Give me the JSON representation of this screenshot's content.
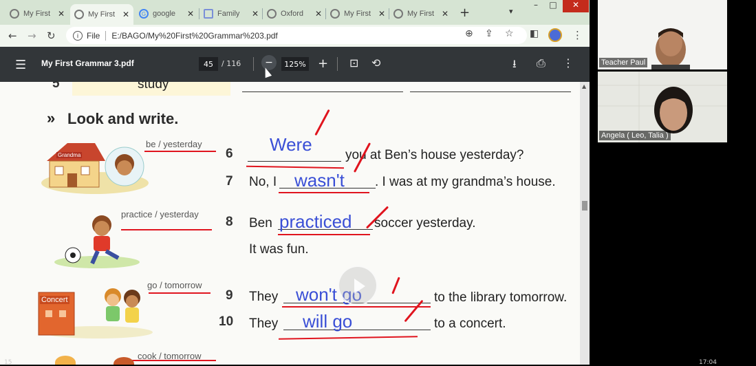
{
  "tabs": [
    {
      "label": "My First",
      "icon": "chrome-icon"
    },
    {
      "label": "My First",
      "icon": "chrome-icon",
      "active": true
    },
    {
      "label": "google",
      "icon": "google-icon"
    },
    {
      "label": "Family",
      "icon": "bookmark-icon"
    },
    {
      "label": "Oxford",
      "icon": "chrome-icon"
    },
    {
      "label": "My First",
      "icon": "chrome-icon"
    },
    {
      "label": "My First",
      "icon": "chrome-icon"
    }
  ],
  "address": {
    "scheme": "File",
    "url": "E:/BAGO/My%20First%20Grammar%203.pdf"
  },
  "pdf": {
    "title": "My First Grammar 3.pdf",
    "page": "45",
    "total": "/ 116",
    "zoom": "125%"
  },
  "worksheet": {
    "prev_num": "5",
    "prev_word": "study",
    "heading": "Look and write.",
    "hints": [
      "be / yesterday",
      "practice / yesterday",
      "go / tomorrow",
      "cook / tomorrow"
    ],
    "items": [
      {
        "num": "6",
        "after": "you at Ben’s house yesterday?",
        "answer": "Were"
      },
      {
        "num": "7",
        "before": "No, I",
        "after": ". I was at my grandma’s house.",
        "answer": "wasn't"
      },
      {
        "num": "8",
        "before": "Ben",
        "after": "soccer yesterday.",
        "answer": "practiced",
        "line2": "It was fun."
      },
      {
        "num": "9",
        "before": "They",
        "after": "to the library tomorrow.",
        "answer": "won't go"
      },
      {
        "num": "10",
        "before": "They",
        "after": "to a concert.",
        "answer": "will go"
      }
    ],
    "pic_labels": {
      "house": "Grandma",
      "concert": "Concert"
    }
  },
  "participants": [
    {
      "name": "Teacher Paul"
    },
    {
      "name": "Angela ( Leo, Talia )"
    }
  ],
  "status": {
    "left": "15",
    "time": "17:04"
  },
  "colors": {
    "tabstrip": "#d6e4d3",
    "pdfbar": "#323639",
    "ink": "#3a4fd6",
    "correction": "#e0141e"
  }
}
